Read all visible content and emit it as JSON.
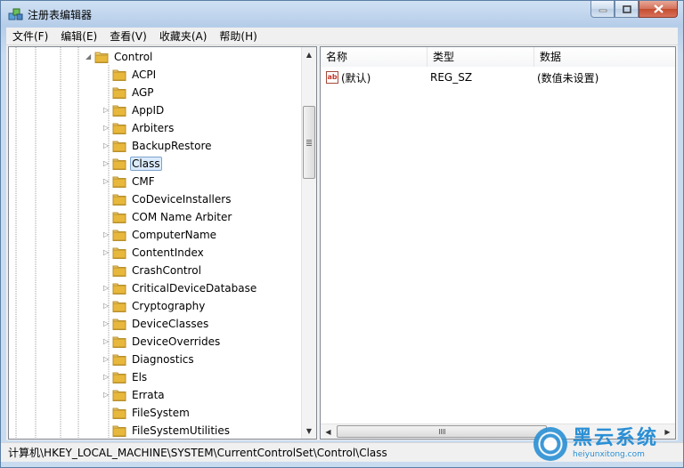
{
  "window": {
    "title": "注册表编辑器",
    "icons": [
      "regedit-icon",
      "minimize-icon",
      "maximize-icon",
      "close-icon"
    ]
  },
  "menu": {
    "items": [
      "文件(F)",
      "编辑(E)",
      "查看(V)",
      "收藏夹(A)",
      "帮助(H)"
    ]
  },
  "tree": {
    "parent": "Control",
    "selected": "Class",
    "items": [
      {
        "label": "ACPI",
        "expandable": false
      },
      {
        "label": "AGP",
        "expandable": false
      },
      {
        "label": "AppID",
        "expandable": true
      },
      {
        "label": "Arbiters",
        "expandable": true
      },
      {
        "label": "BackupRestore",
        "expandable": true
      },
      {
        "label": "Class",
        "expandable": true
      },
      {
        "label": "CMF",
        "expandable": true
      },
      {
        "label": "CoDeviceInstallers",
        "expandable": false
      },
      {
        "label": "COM Name Arbiter",
        "expandable": false
      },
      {
        "label": "ComputerName",
        "expandable": true
      },
      {
        "label": "ContentIndex",
        "expandable": true
      },
      {
        "label": "CrashControl",
        "expandable": false
      },
      {
        "label": "CriticalDeviceDatabase",
        "expandable": true
      },
      {
        "label": "Cryptography",
        "expandable": true
      },
      {
        "label": "DeviceClasses",
        "expandable": true
      },
      {
        "label": "DeviceOverrides",
        "expandable": true
      },
      {
        "label": "Diagnostics",
        "expandable": true
      },
      {
        "label": "Els",
        "expandable": true
      },
      {
        "label": "Errata",
        "expandable": true
      },
      {
        "label": "FileSystem",
        "expandable": false
      },
      {
        "label": "FileSystemUtilities",
        "expandable": false
      }
    ]
  },
  "list": {
    "columns": [
      "名称",
      "类型",
      "数据"
    ],
    "rows": [
      {
        "name": "(默认)",
        "type": "REG_SZ",
        "data": "(数值未设置)"
      }
    ]
  },
  "status": {
    "path": "计算机\\HKEY_LOCAL_MACHINE\\SYSTEM\\CurrentControlSet\\Control\\Class"
  },
  "watermark": {
    "title": "黑云系统",
    "subtitle": "heiyunxitong.com"
  },
  "colors": {
    "folder": "#e8b83c",
    "selection": "#dcebfc",
    "watermark": "#2a8fd4"
  }
}
